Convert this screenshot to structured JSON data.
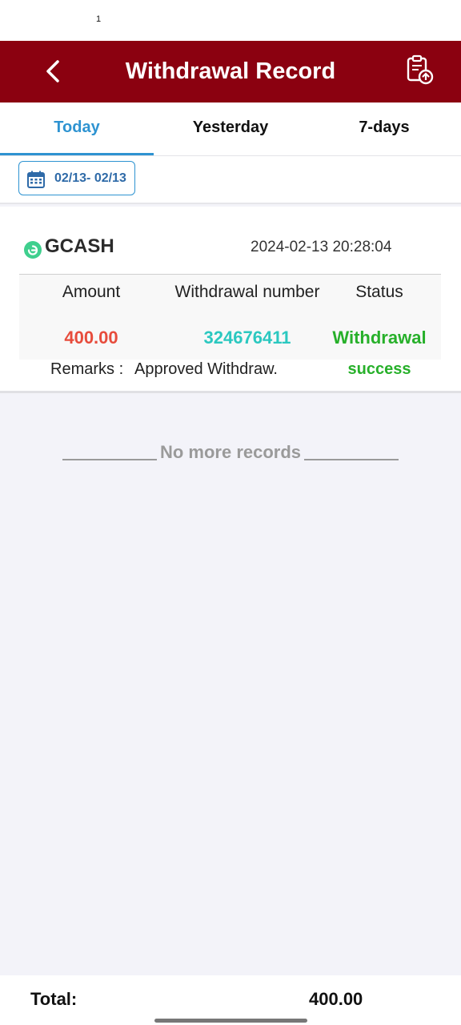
{
  "status_bar": {
    "glyph": "1"
  },
  "header": {
    "title": "Withdrawal Record",
    "back_icon": "chevron-left-icon",
    "record_icon": "clipboard-upload-icon"
  },
  "tabs": [
    {
      "label": "Today",
      "active": true
    },
    {
      "label": "Yesterday",
      "active": false
    },
    {
      "label": "7-days",
      "active": false
    }
  ],
  "date_filter": {
    "range": "02/13- 02/13",
    "icon": "calendar-icon"
  },
  "record": {
    "method": "GCASH",
    "datetime": "2024-02-13 20:28:04",
    "headers": {
      "amount": "Amount",
      "number": "Withdrawal number",
      "status": "Status"
    },
    "amount": "400.00",
    "number": "324676411",
    "status_line1": "Withdrawal",
    "status_line2": "success",
    "remarks_label": "Remarks :",
    "remarks_value": "Approved Withdraw."
  },
  "no_more": "No more records",
  "footer": {
    "total_label": "Total:",
    "total_value": "400.00"
  },
  "colors": {
    "header_bg": "#8b0110",
    "accent": "#2e93d1",
    "amount": "#e74c3c",
    "number": "#2bc8c0",
    "success": "#27b02a"
  }
}
